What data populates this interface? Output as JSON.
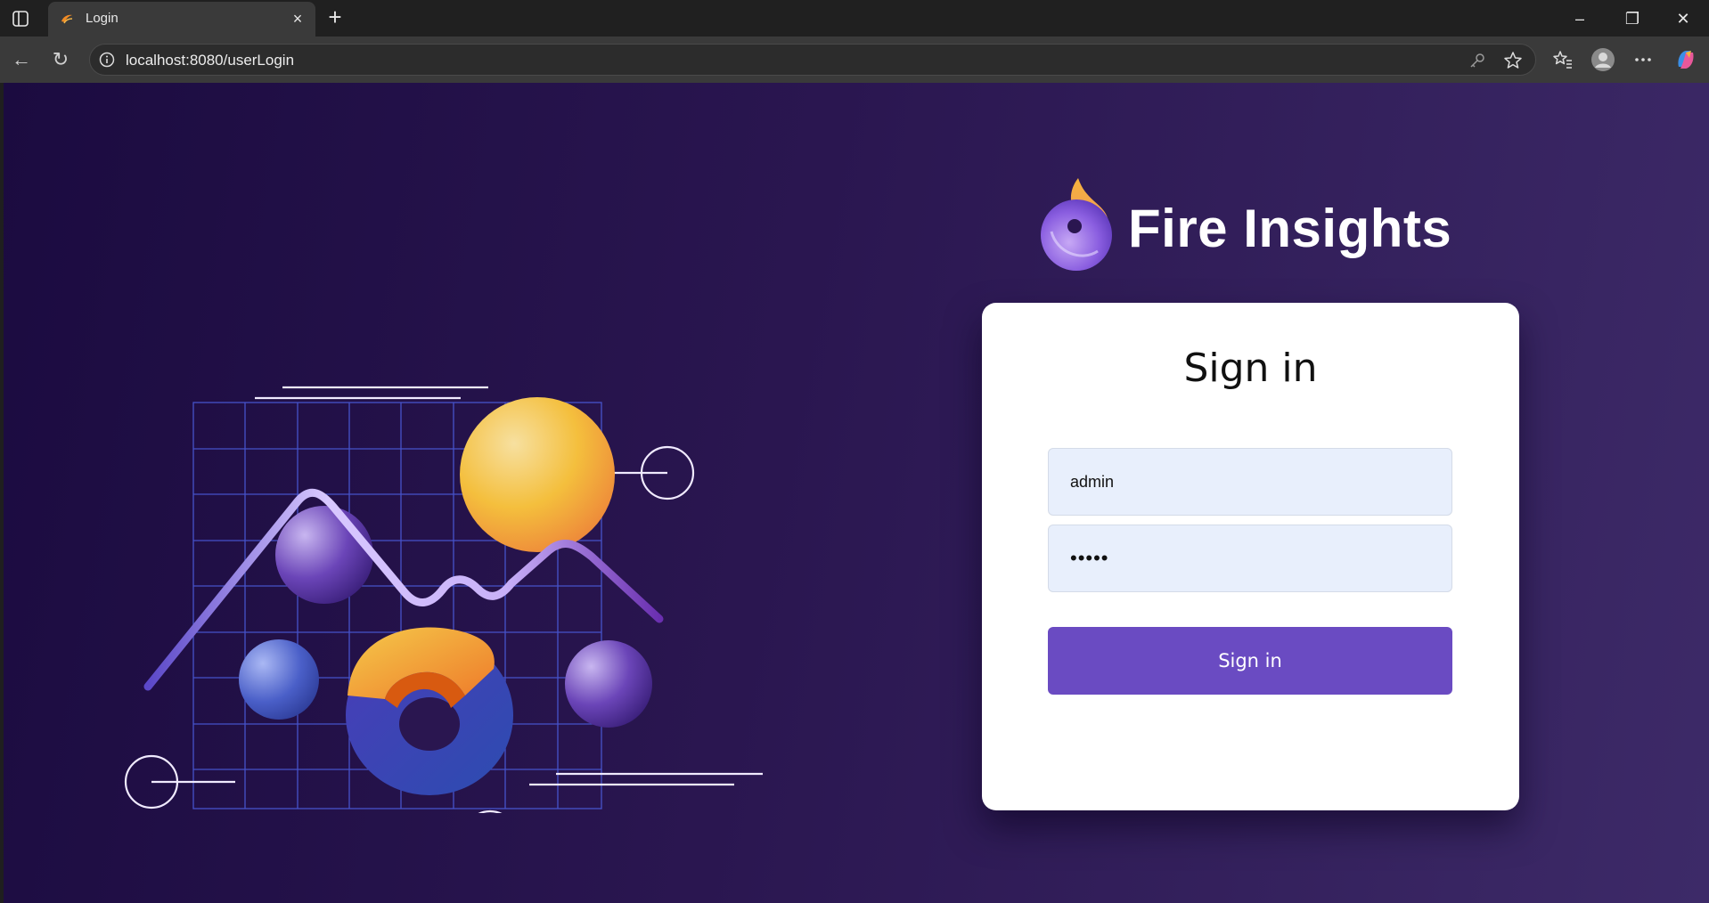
{
  "browser": {
    "tab_title": "Login",
    "new_tab_label": "+",
    "close_tab_label": "×",
    "url": "localhost:8080/userLogin",
    "window_controls": {
      "minimize": "–",
      "restore": "❐",
      "close": "✕"
    },
    "nav": {
      "back": "←",
      "reload": "↻"
    },
    "icons": [
      "sidebar-toggle-icon",
      "favicon-icon",
      "info-icon",
      "key-icon",
      "star-icon",
      "favorites-icon",
      "profile-icon",
      "more-icon",
      "copilot-icon"
    ]
  },
  "brand": {
    "name": "Fire Insights",
    "logo_icon": "flame-logo-icon"
  },
  "login": {
    "title": "Sign in",
    "username_value": "admin",
    "password_value": "•••••",
    "submit_label": "Sign in"
  },
  "colors": {
    "background_start": "#1b0b40",
    "background_end": "#3d2a68",
    "button": "#6a4bc2",
    "input_bg": "#e8effc",
    "card": "#ffffff"
  }
}
